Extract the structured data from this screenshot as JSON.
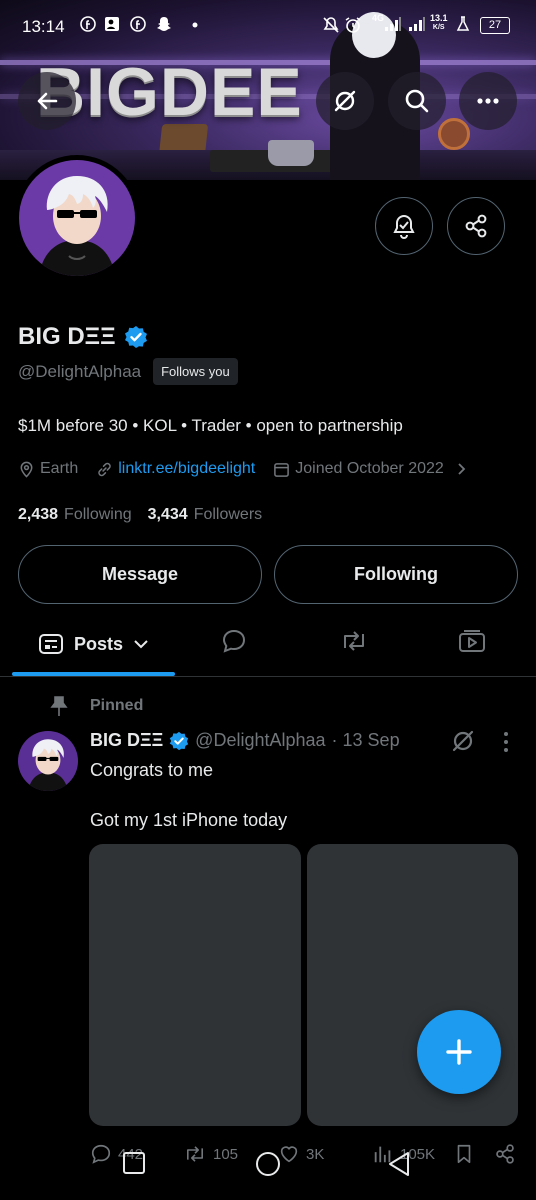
{
  "status_bar": {
    "time": "13:14",
    "network": "4G",
    "speed_value": "13.1",
    "speed_unit": "K/S",
    "battery": "27"
  },
  "banner": {
    "title": "BIGDEE"
  },
  "profile": {
    "display_name": "BIG DΞΞ",
    "verified": true,
    "handle": "@DelightAlphaa",
    "follows_you": "Follows you",
    "bio": "$1M before 30 • KOL • Trader • open to partnership",
    "location": "Earth",
    "link": "linktr.ee/bigdeelight",
    "joined": "Joined October 2022",
    "following_count": "2,438",
    "following_label": "Following",
    "followers_count": "3,434",
    "followers_label": "Followers"
  },
  "actions": {
    "message": "Message",
    "following": "Following"
  },
  "tabs": {
    "posts": "Posts"
  },
  "post": {
    "pinned_label": "Pinned",
    "author_name": "BIG DΞΞ",
    "author_handle": "@DelightAlphaa",
    "date": "· 13 Sep",
    "line1": "Congrats to me",
    "line2": "Got my 1st iPhone today",
    "replies": "442",
    "reposts": "105",
    "likes": "3K",
    "views": "105K"
  },
  "colors": {
    "accent": "#1d9bf0",
    "background": "#000000",
    "secondary_text": "#71767b",
    "border": "#536471"
  },
  "icons": [
    "back-arrow-icon",
    "grok-icon",
    "search-icon",
    "more-icon",
    "notification-bell-icon",
    "share-icon",
    "verified-badge-icon",
    "location-icon",
    "link-icon",
    "calendar-icon",
    "chevron-right-icon",
    "posts-tab-icon",
    "chevron-down-icon",
    "replies-tab-icon",
    "reposts-tab-icon",
    "media-tab-icon",
    "pin-icon",
    "reply-icon",
    "repost-icon",
    "like-icon",
    "views-icon",
    "bookmark-icon",
    "compose-plus-icon"
  ]
}
